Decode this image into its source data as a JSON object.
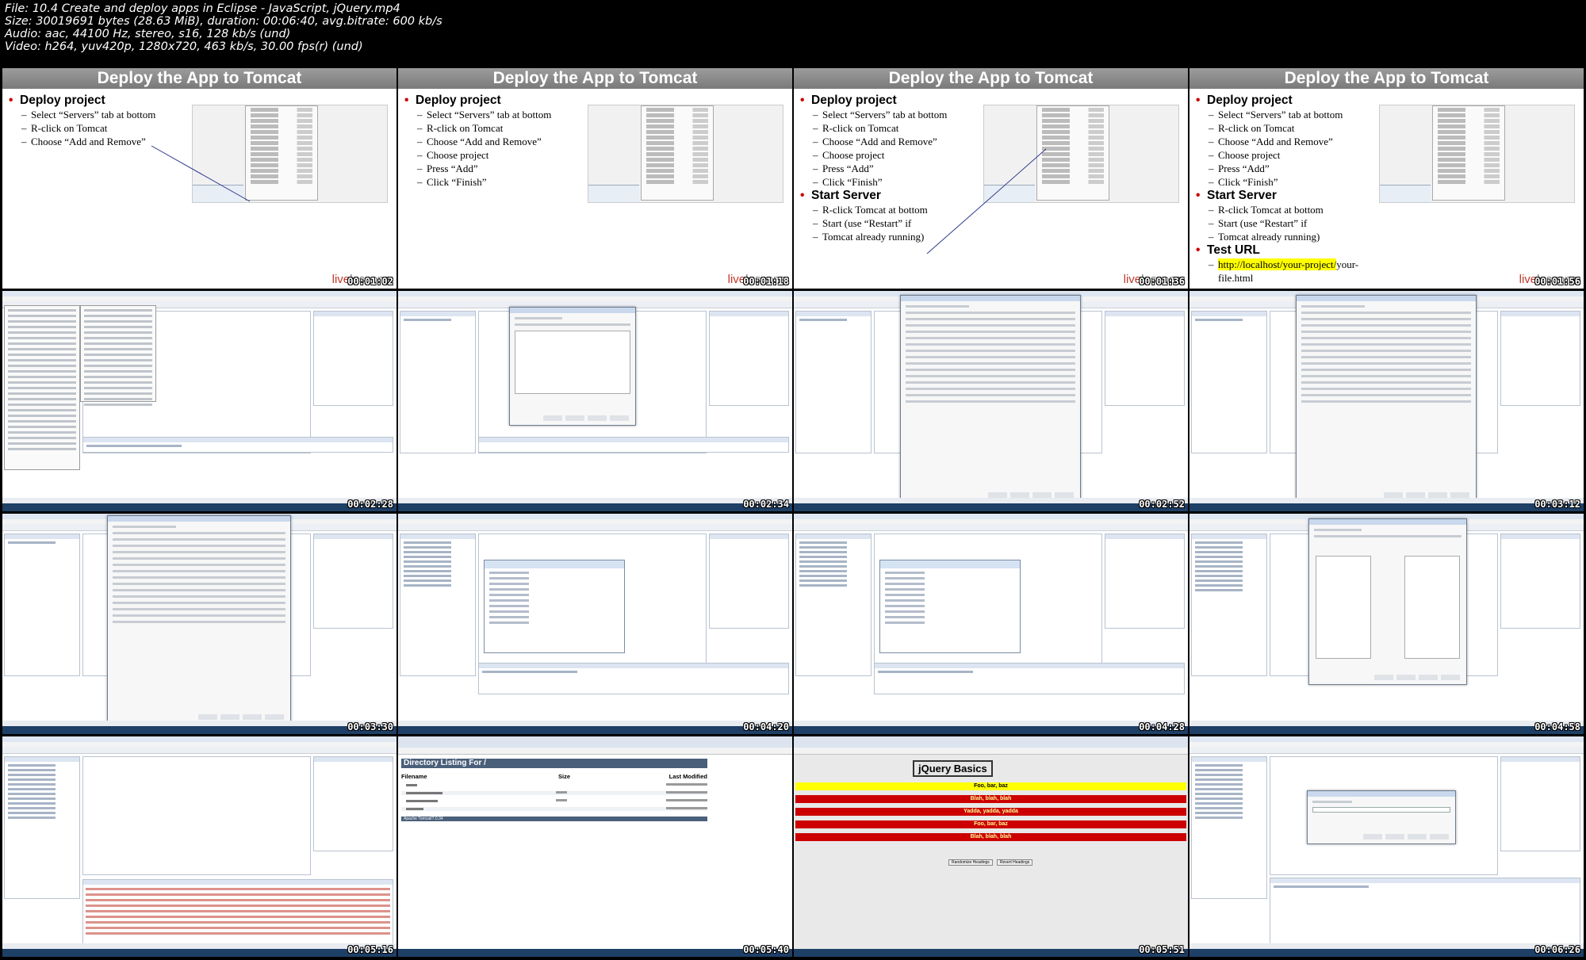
{
  "meta": {
    "line1": "File: 10.4 Create and deploy apps in Eclipse - JavaScript, jQuery.mp4",
    "line2": "Size: 30019691 bytes (28.63 MiB), duration: 00:06:40, avg.bitrate: 600 kb/s",
    "line3": "Audio: aac, 44100 Hz, stereo, s16, 128 kb/s (und)",
    "line4": "Video: h264, yuv420p, 1280x720, 463 kb/s, 30.00 fps(r) (und)"
  },
  "slide": {
    "title": "Deploy the App to Tomcat",
    "logo_a": "live",
    "logo_b": "lessons",
    "deploy": "Deploy project",
    "d1": "Select “Servers” tab at bottom",
    "d2": "R-click on Tomcat",
    "d3": "Choose “Add and Remove”",
    "d4": "Choose project",
    "d5": "Press “Add”",
    "d6": "Click “Finish”",
    "start": "Start Server",
    "s1": "R-click Tomcat at bottom",
    "s2a": "Start (use “Restart” if",
    "s2b": "Tomcat already running)",
    "test": "Test URL",
    "url_a": "http://localhost/your-project/",
    "url_b": "your-file.html"
  },
  "timestamps": [
    "00:01:02",
    "00:01:18",
    "00:01:36",
    "00:01:56",
    "00:02:28",
    "00:02:34",
    "00:02:52",
    "00:03:12",
    "00:03:30",
    "00:04:20",
    "00:04:28",
    "00:04:58",
    "00:05:16",
    "00:05:40",
    "00:05:51",
    "00:06:26"
  ],
  "dir": {
    "heading": "Directory Listing For /",
    "col_filename": "Filename",
    "col_size": "Size",
    "col_modified": "Last Modified",
    "footer": "Apache Tomcat/7.0.34"
  },
  "jquery": {
    "title": "jQuery Basics",
    "bar1": "Foo, bar, baz",
    "bar2": "Blah, blah, blah",
    "bar3": "Yadda, yadda, yadda",
    "bar4": "Foo, bar, baz",
    "bar5": "Blah, blah, blah",
    "btn1": "Randomize Headings",
    "btn2": "Revert Headings"
  },
  "colors": {
    "yellow": "#ffff00",
    "red": "#cc0000",
    "header_gray": "#8c8c8c",
    "taskbar": "#1e3f66"
  }
}
